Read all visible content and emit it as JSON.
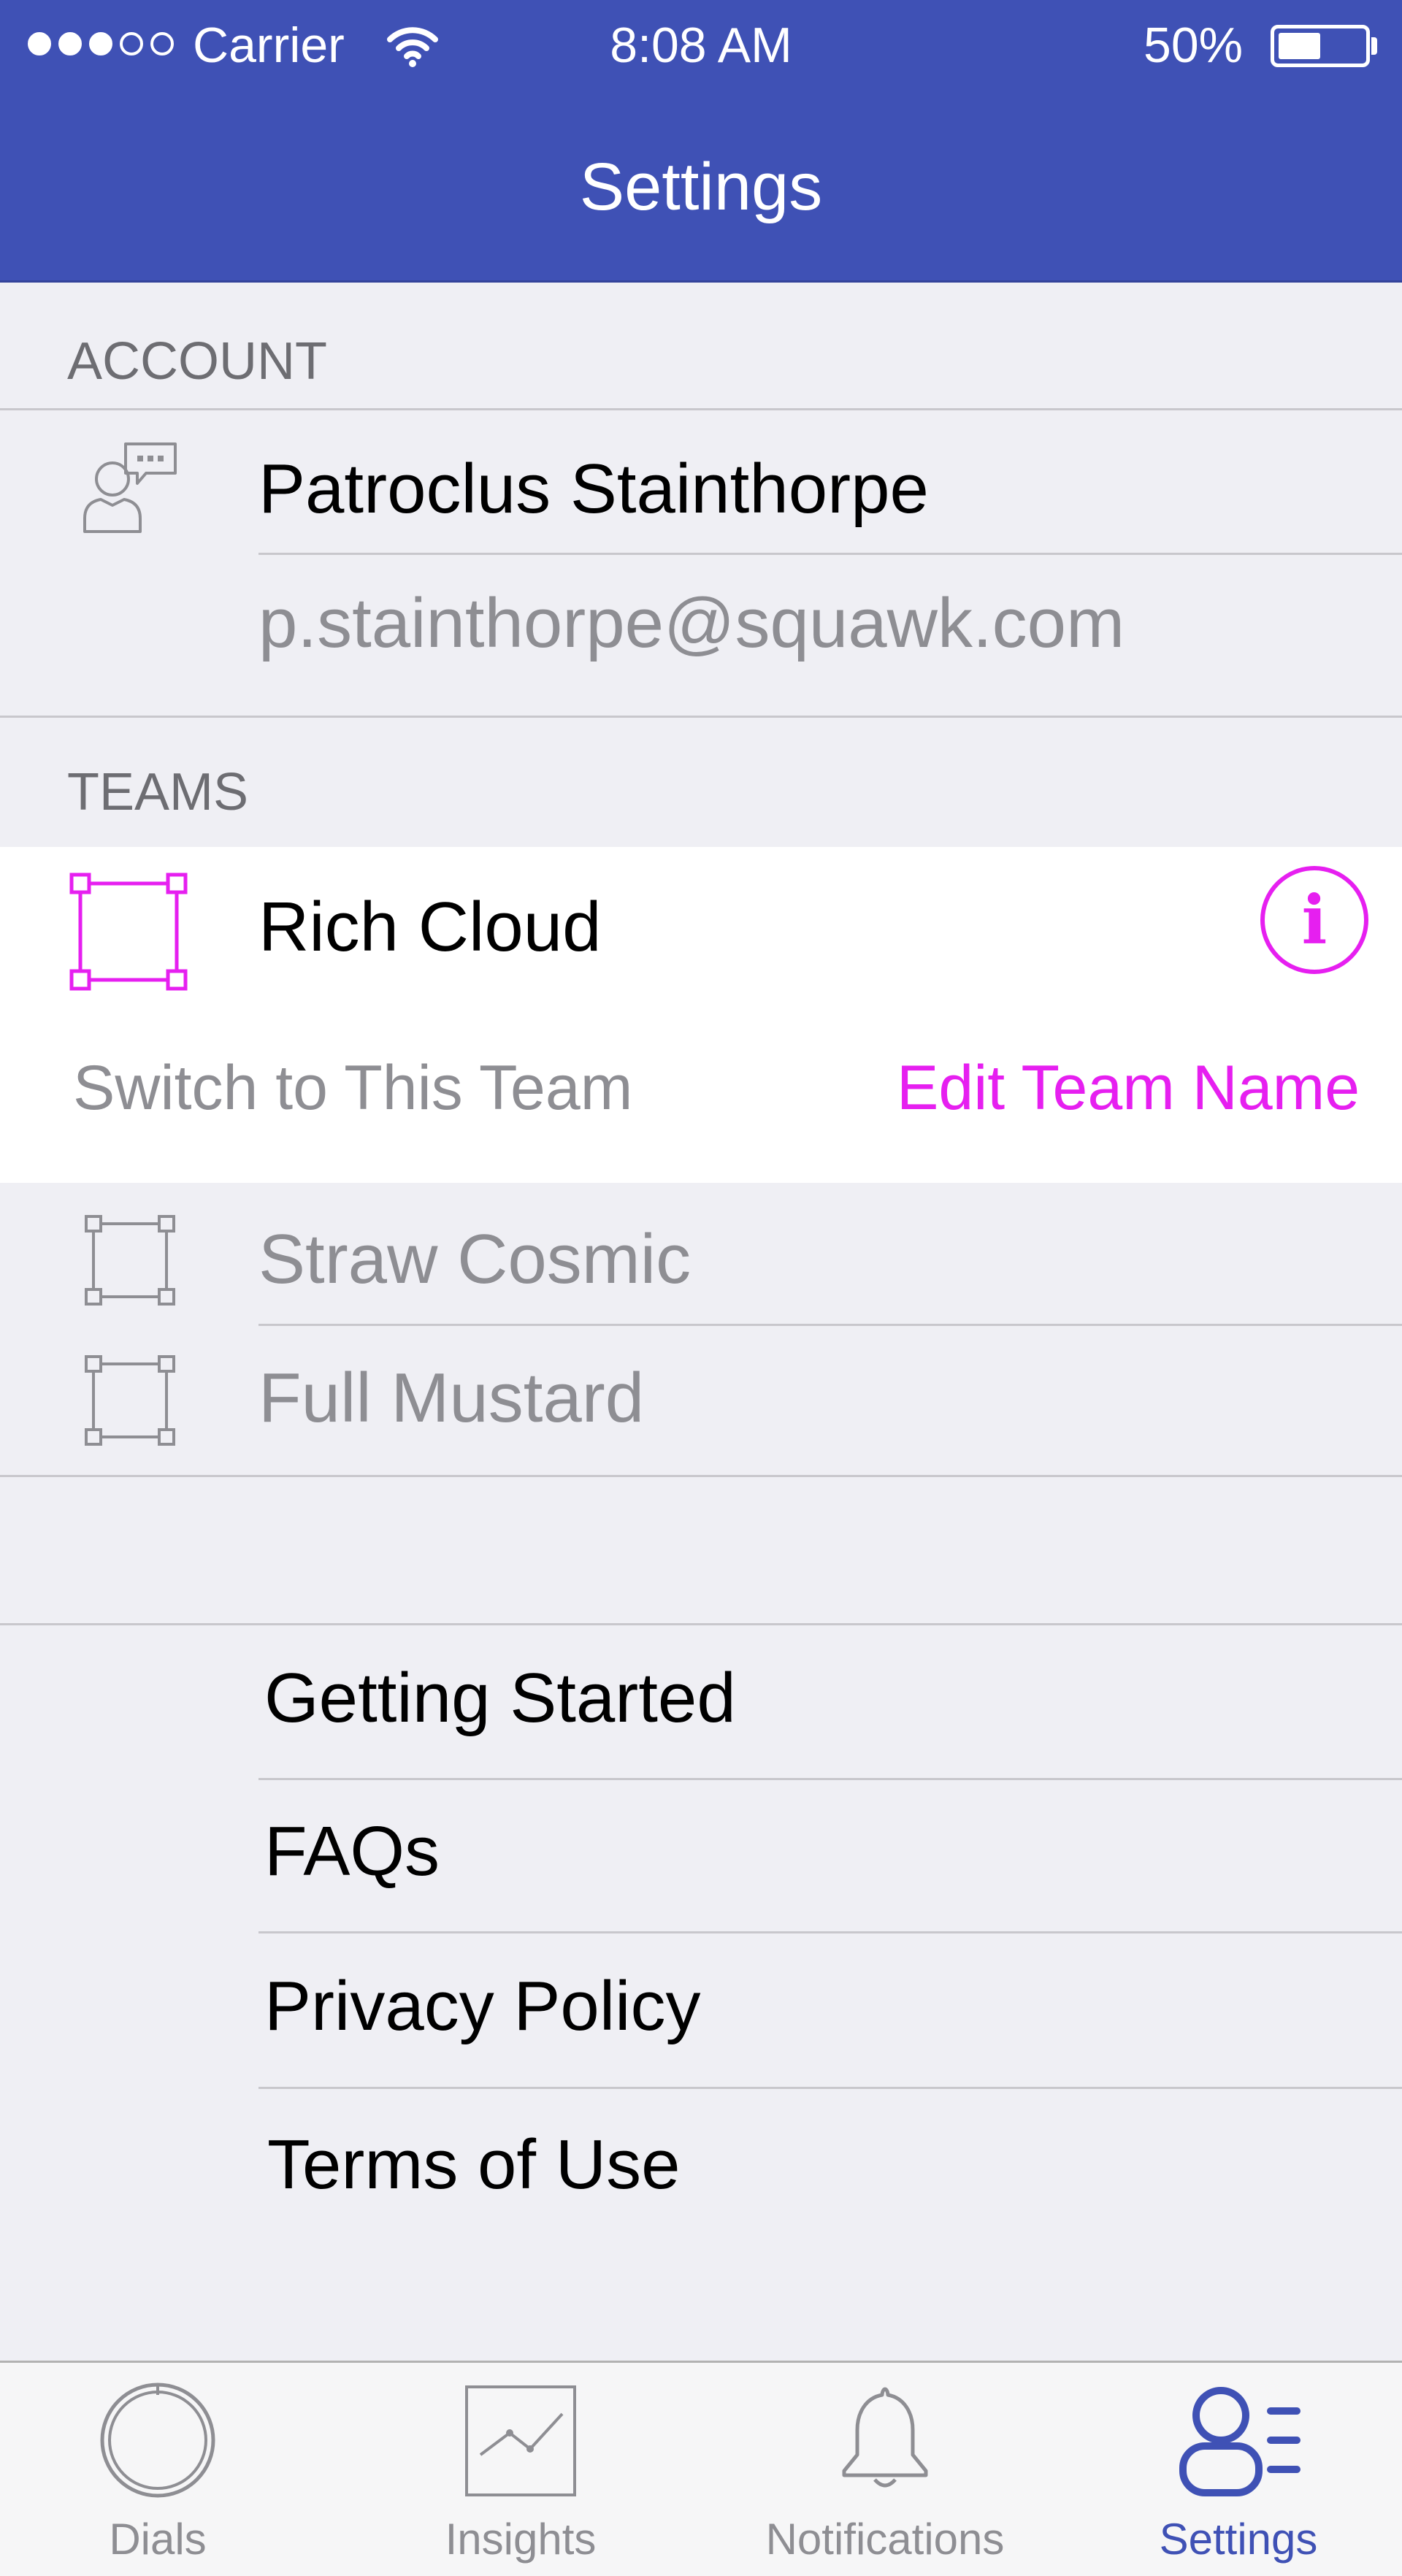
{
  "status_bar": {
    "carrier": "Carrier",
    "time": "8:08 AM",
    "battery_text": "50%",
    "battery_level": 0.5,
    "signal_bars_filled": 3,
    "signal_bars_total": 5
  },
  "nav": {
    "title": "Settings"
  },
  "account": {
    "header": "ACCOUNT",
    "name": "Patroclus Stainthorpe",
    "email": "p.stainthorpe@squawk.com"
  },
  "teams": {
    "header": "TEAMS",
    "selected": {
      "name": "Rich Cloud",
      "switch_label": "Switch to This Team",
      "edit_label": "Edit Team Name"
    },
    "others": [
      {
        "name": "Straw Cosmic"
      },
      {
        "name": "Full Mustard"
      }
    ]
  },
  "links": [
    {
      "label": "Getting Started"
    },
    {
      "label": "FAQs"
    },
    {
      "label": "Privacy Policy"
    },
    {
      "label": "Terms of Use"
    }
  ],
  "tabs": [
    {
      "label": "Dials",
      "icon": "dial-icon",
      "active": false
    },
    {
      "label": "Insights",
      "icon": "chart-icon",
      "active": false
    },
    {
      "label": "Notifications",
      "icon": "bell-icon",
      "active": false
    },
    {
      "label": "Settings",
      "icon": "settings-profile-icon",
      "active": true
    }
  ],
  "colors": {
    "nav_background": "#3f51b5",
    "accent": "#e61ff0",
    "active_tab": "#3f51b5",
    "inactive_tab": "#8e8e93"
  },
  "icons": {
    "wifi": "wifi-icon",
    "battery": "battery-icon",
    "account": "user-chat-icon",
    "team_selected": "team-square-icon",
    "team_other": "team-square-icon",
    "info": "info-icon"
  }
}
